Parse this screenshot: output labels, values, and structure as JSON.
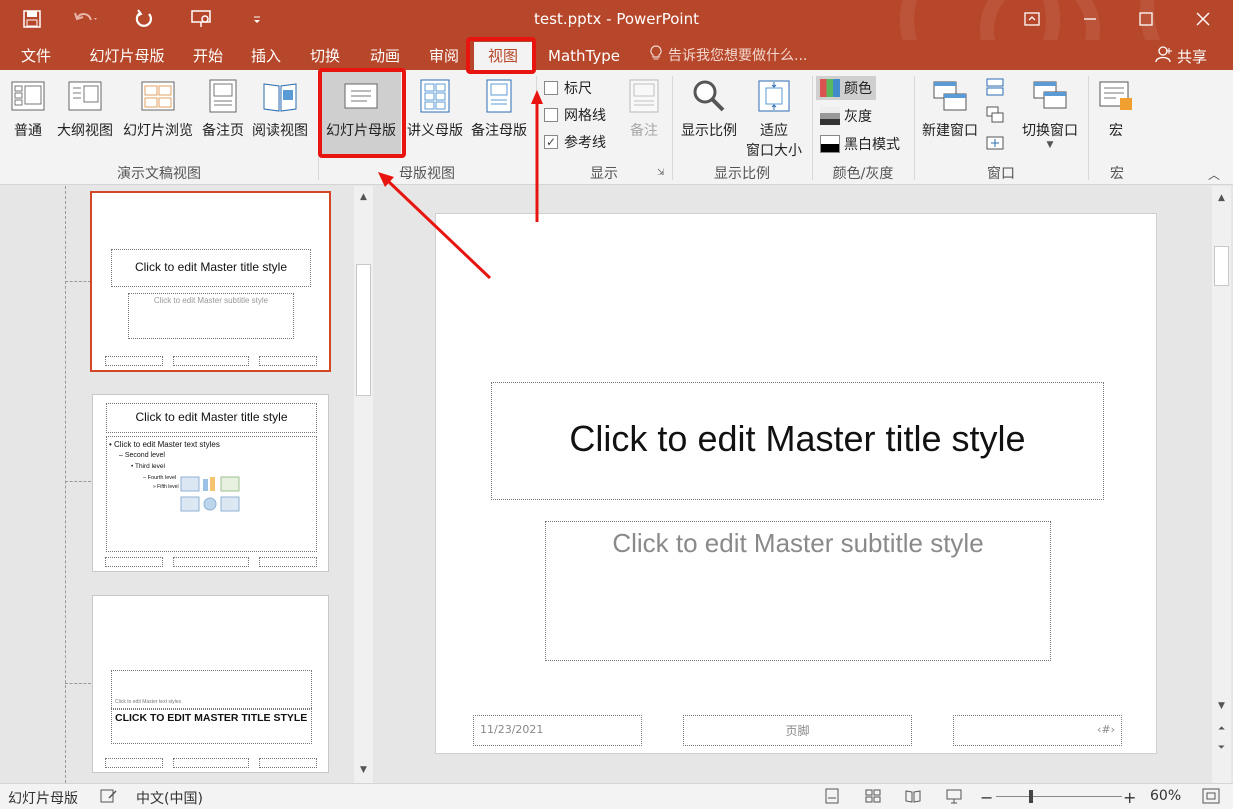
{
  "titlebar": {
    "title": "test.pptx - PowerPoint",
    "icons": [
      "save-icon",
      "undo-icon",
      "redo-icon",
      "presentation-icon",
      "customize-icon"
    ],
    "window_buttons": [
      "ribbon-display-icon",
      "minimize-icon",
      "maximize-icon",
      "close-icon"
    ]
  },
  "tabs": [
    "文件",
    "幻灯片母版",
    "开始",
    "插入",
    "切换",
    "动画",
    "审阅",
    "视图",
    "MathType"
  ],
  "active_tab": "视图",
  "tell_me": "告诉我您想要做什么...",
  "share": "共享",
  "ribbon": {
    "presentation_views": {
      "label": "演示文稿视图",
      "buttons": [
        "普通",
        "大纲视图",
        "幻灯片浏览",
        "备注页",
        "阅读视图"
      ]
    },
    "master_views": {
      "label": "母版视图",
      "buttons": [
        "幻灯片母版",
        "讲义母版",
        "备注母版"
      ]
    },
    "show": {
      "label": "显示",
      "checkboxes": [
        {
          "label": "标尺",
          "checked": false
        },
        {
          "label": "网格线",
          "checked": false
        },
        {
          "label": "参考线",
          "checked": true
        }
      ],
      "notes": "备注"
    },
    "zoom": {
      "label": "显示比例",
      "zoom_btn": "显示比例",
      "fit_line1": "适应",
      "fit_line2": "窗口大小"
    },
    "color": {
      "label": "颜色/灰度",
      "options": [
        "颜色",
        "灰度",
        "黑白模式"
      ],
      "selected": "颜色"
    },
    "window": {
      "label": "窗口",
      "new_window": "新建窗口",
      "switch_window": "切换窗口"
    },
    "macros": {
      "label": "宏",
      "button": "宏"
    }
  },
  "thumbnails": [
    {
      "title": "Click to edit Master title style",
      "subtitle": "Click to edit Master subtitle style"
    },
    {
      "title": "Click to edit Master title style",
      "levels": [
        "Click to edit Master text styles",
        "Second level",
        "Third level",
        "Fourth level",
        "Fifth level"
      ]
    },
    {
      "small_text": "Click to edit Master text styles",
      "title": "CLICK TO EDIT MASTER TITLE STYLE"
    }
  ],
  "slide": {
    "title": "Click to edit Master title style",
    "subtitle": "Click to edit Master subtitle style",
    "date": "11/23/2021",
    "footer": "页脚",
    "page_number": "‹#›"
  },
  "statusbar": {
    "view": "幻灯片母版",
    "language": "中文(中国)",
    "zoom": "60%",
    "zoom_level": 0.6
  },
  "colors": {
    "accent": "#b7472a",
    "annotation": "#e8140f"
  }
}
